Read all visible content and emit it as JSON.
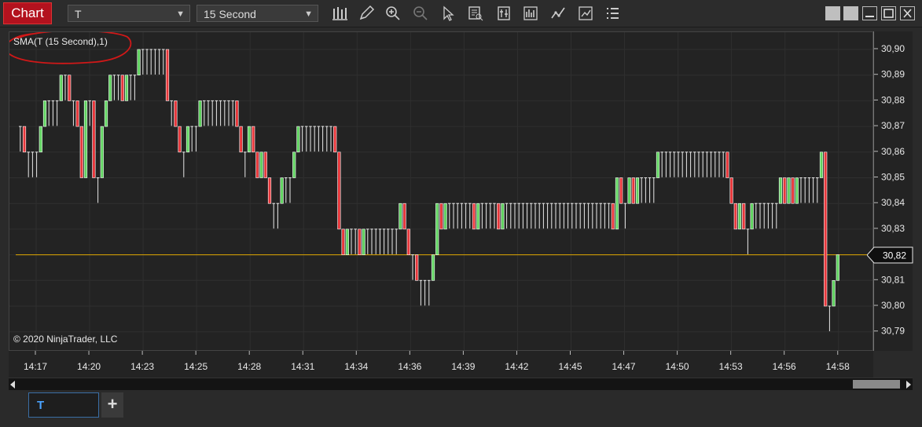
{
  "toolbar": {
    "chart_tab_label": "Chart",
    "instrument_value": "T",
    "interval_value": "15 Second",
    "icons": [
      "bar-type-icon",
      "drawing-tool-icon",
      "zoom-in-icon",
      "zoom-out-icon",
      "pointer-icon",
      "data-box-icon",
      "properties-icon",
      "strategies-icon",
      "indicators-icon",
      "templates-icon",
      "menu-icon"
    ]
  },
  "window_controls": [
    "restore-left-icon",
    "restore-right-icon",
    "minimize-icon",
    "maximize-icon",
    "close-icon"
  ],
  "chart": {
    "indicator_label": "SMA(T (15 Second),1)",
    "copyright": "© 2020 NinjaTrader, LLC",
    "colors": {
      "background": "#232323",
      "up": "#5fd35f",
      "down": "#e8373b",
      "flat": "#dcdcdc",
      "current_line": "#e0a800",
      "annotation": "#d01818"
    }
  },
  "bottom_tabs": {
    "active_tab": "T",
    "add_label": "+"
  },
  "chart_data": {
    "type": "candlestick",
    "price_ticks": [
      "30,90",
      "30,89",
      "30,88",
      "30,87",
      "30,86",
      "30,85",
      "30,84",
      "30,83",
      "30,82",
      "30,81",
      "30,80",
      "30,79"
    ],
    "current_price_label": "30,82",
    "current_price": 30.82,
    "ylim": [
      30.79,
      30.9
    ],
    "time_ticks": [
      "14:17",
      "14:20",
      "14:23",
      "14:25",
      "14:28",
      "14:31",
      "14:34",
      "14:36",
      "14:39",
      "14:42",
      "14:45",
      "14:47",
      "14:50",
      "14:53",
      "14:56",
      "14:58"
    ],
    "bar_closes": [
      30.87,
      30.86,
      30.86,
      30.86,
      30.86,
      30.87,
      30.88,
      30.88,
      30.88,
      30.88,
      30.89,
      30.89,
      30.88,
      30.88,
      30.87,
      30.85,
      30.88,
      30.88,
      30.85,
      30.85,
      30.87,
      30.88,
      30.89,
      30.89,
      30.89,
      30.88,
      30.89,
      30.89,
      30.89,
      30.9,
      30.9,
      30.9,
      30.9,
      30.9,
      30.9,
      30.9,
      30.88,
      30.88,
      30.87,
      30.86,
      30.86,
      30.87,
      30.87,
      30.87,
      30.88,
      30.88,
      30.88,
      30.88,
      30.88,
      30.88,
      30.88,
      30.88,
      30.88,
      30.87,
      30.86,
      30.86,
      30.87,
      30.86,
      30.85,
      30.86,
      30.85,
      30.84,
      30.84,
      30.84,
      30.85,
      30.85,
      30.85,
      30.86,
      30.87,
      30.87,
      30.87,
      30.87,
      30.87,
      30.87,
      30.87,
      30.87,
      30.87,
      30.86,
      30.83,
      30.82,
      30.83,
      30.83,
      30.83,
      30.82,
      30.83,
      30.83,
      30.83,
      30.83,
      30.83,
      30.83,
      30.83,
      30.83,
      30.83,
      30.84,
      30.83,
      30.82,
      30.82,
      30.81,
      30.81,
      30.81,
      30.81,
      30.82,
      30.84,
      30.83,
      30.84,
      30.84,
      30.84,
      30.84,
      30.84,
      30.84,
      30.84,
      30.83,
      30.84,
      30.84,
      30.84,
      30.84,
      30.84,
      30.83,
      30.84,
      30.84,
      30.84,
      30.84,
      30.84,
      30.84,
      30.84,
      30.84,
      30.84,
      30.84,
      30.84,
      30.84,
      30.84,
      30.84,
      30.84,
      30.84,
      30.84,
      30.84,
      30.84,
      30.84,
      30.84,
      30.84,
      30.84,
      30.84,
      30.84,
      30.84,
      30.84,
      30.83,
      30.85,
      30.84,
      30.84,
      30.85,
      30.84,
      30.85,
      30.85,
      30.85,
      30.85,
      30.85,
      30.86,
      30.86,
      30.86,
      30.86,
      30.86,
      30.86,
      30.86,
      30.86,
      30.86,
      30.86,
      30.86,
      30.86,
      30.86,
      30.86,
      30.86,
      30.86,
      30.86,
      30.85,
      30.84,
      30.83,
      30.84,
      30.83,
      30.83,
      30.84,
      30.84,
      30.84,
      30.84,
      30.84,
      30.84,
      30.84,
      30.85,
      30.84,
      30.85,
      30.84,
      30.85,
      30.85,
      30.85,
      30.85,
      30.85,
      30.85,
      30.86,
      30.8,
      30.8,
      30.81,
      30.82
    ]
  }
}
